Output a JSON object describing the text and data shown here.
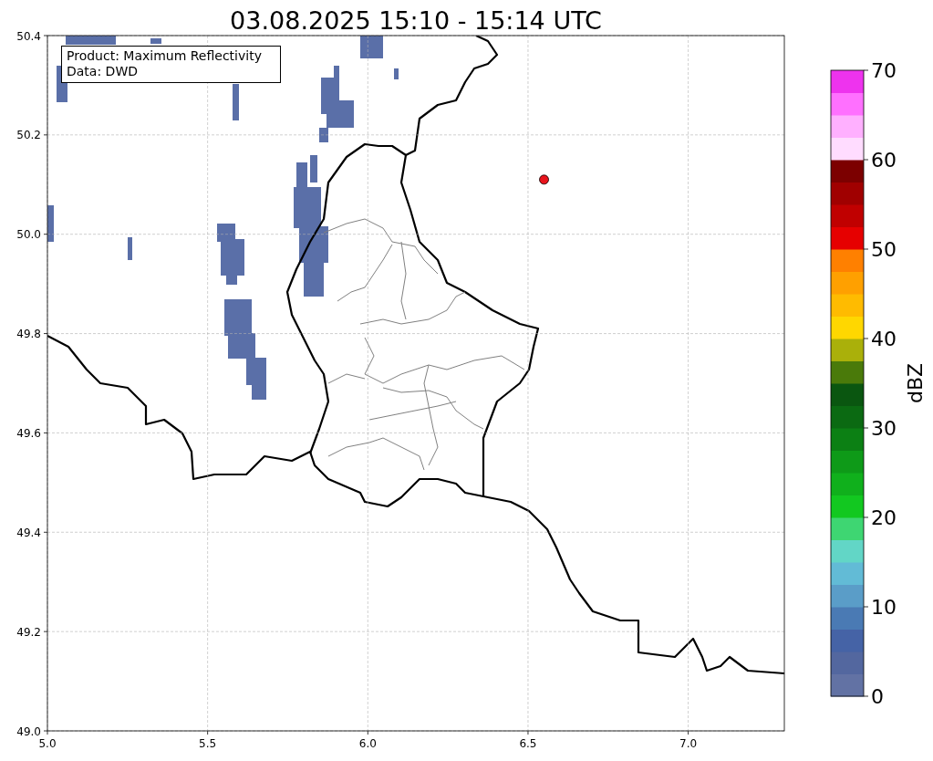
{
  "title": "03.08.2025 15:10 - 15:14 UTC",
  "legend": [
    "Product: Maximum Reflectivity",
    "Data: DWD"
  ],
  "chart_data": {
    "type": "scatter",
    "xlim": [
      5.0,
      7.3
    ],
    "ylim": [
      49.0,
      50.4
    ],
    "grid": true,
    "xticks": [
      {
        "value": 5.0,
        "label": "5.0"
      },
      {
        "value": 5.5,
        "label": "5.5"
      },
      {
        "value": 6.0,
        "label": "6.0"
      },
      {
        "value": 6.5,
        "label": "6.5"
      },
      {
        "value": 7.0,
        "label": "7.0"
      }
    ],
    "yticks": [
      {
        "value": 49.0,
        "label": "49.0"
      },
      {
        "value": 49.2,
        "label": "49.2"
      },
      {
        "value": 49.4,
        "label": "49.4"
      },
      {
        "value": 49.6,
        "label": "49.6"
      },
      {
        "value": 49.8,
        "label": "49.8"
      },
      {
        "value": 50.0,
        "label": "50.0"
      },
      {
        "value": 50.2,
        "label": "50.2"
      },
      {
        "value": 50.4,
        "label": "50.4"
      }
    ],
    "series": [
      {
        "color": "#e8141c",
        "x": [
          6.55
        ],
        "values": [
          50.11
        ]
      }
    ]
  },
  "colorbar": {
    "label": "dBZ",
    "ticks": [
      "70",
      "60",
      "50",
      "40",
      "30",
      "20",
      "10",
      "0"
    ],
    "bands": [
      {
        "color": "#6272a4"
      },
      {
        "color": "#53679f"
      },
      {
        "color": "#4563a6"
      },
      {
        "color": "#4a7ab4"
      },
      {
        "color": "#5a9dc8"
      },
      {
        "color": "#62bbd6"
      },
      {
        "color": "#62d6c6"
      },
      {
        "color": "#3ed672"
      },
      {
        "color": "#12c820"
      },
      {
        "color": "#10b01c"
      },
      {
        "color": "#0e9a18"
      },
      {
        "color": "#0c8014"
      },
      {
        "color": "#0b6a12"
      },
      {
        "color": "#0a5610"
      },
      {
        "color": "#4a7a0a"
      },
      {
        "color": "#aab00a"
      },
      {
        "color": "#ffd700"
      },
      {
        "color": "#ffbb00"
      },
      {
        "color": "#ffa000"
      },
      {
        "color": "#ff8000"
      },
      {
        "color": "#e60000"
      },
      {
        "color": "#c00000"
      },
      {
        "color": "#a00000"
      },
      {
        "color": "#7c0000"
      },
      {
        "color": "#ffdcff"
      },
      {
        "color": "#ffb0ff"
      },
      {
        "color": "#ff70ff"
      },
      {
        "color": "#ee33ee"
      }
    ]
  }
}
